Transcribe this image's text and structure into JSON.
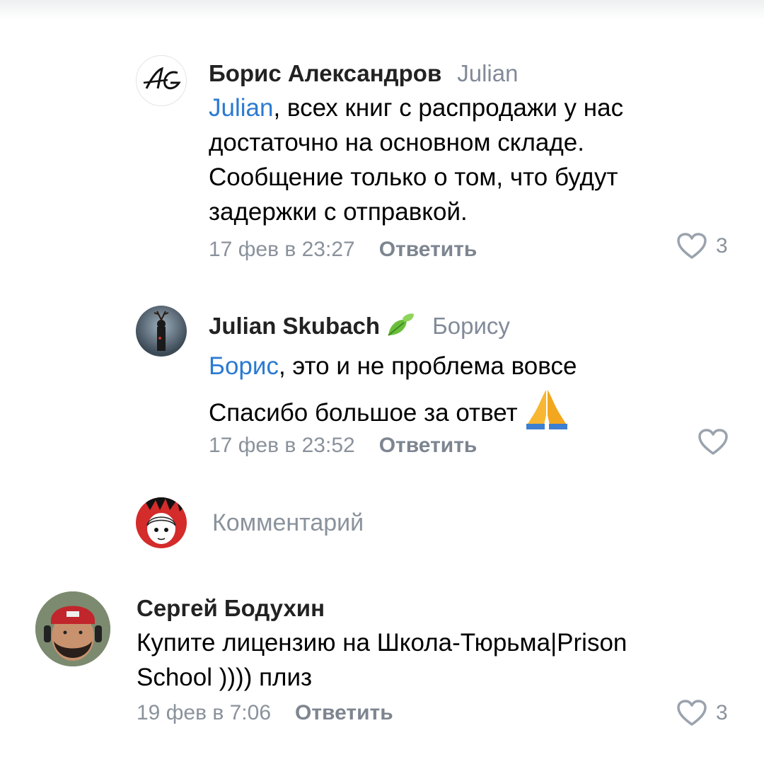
{
  "comments": [
    {
      "author": "Борис Александров",
      "reply_to": "Julian",
      "mention": "Julian",
      "text_after_mention": ", всех книг с распродажи у нас",
      "lines": [
        "достаточно на основном складе.",
        "Сообщение только о том, что будут",
        "задержки с отправкой."
      ],
      "time": "17 фев в 23:27",
      "reply_label": "Ответить",
      "likes": "3"
    },
    {
      "author": "Julian Skubach",
      "reply_to": "Борису",
      "mention": "Борис",
      "text_after_mention": ", это и не проблема вовсе",
      "lines": [
        "Спасибо большое за ответ"
      ],
      "time": "17 фев в 23:52",
      "reply_label": "Ответить",
      "likes": ""
    },
    {
      "author": "Сергей Бодухин",
      "lines": [
        "Купите лицензию на Школа-Тюрьма|Prison",
        "School )))) плиз"
      ],
      "time": "19 фев в 7:06",
      "reply_label": "Ответить",
      "likes": "3"
    }
  ],
  "composer": {
    "placeholder": "Комментарий"
  },
  "colors": {
    "link": "#2a7ad1",
    "secondary": "#828a99",
    "heart": "#9aa3ad"
  },
  "icons": [
    "heart-icon",
    "leaf-emoji",
    "folded-hands-emoji",
    "avatar-ag-logo",
    "avatar-antler-figure",
    "avatar-anime-girl",
    "avatar-man-red-cap"
  ]
}
